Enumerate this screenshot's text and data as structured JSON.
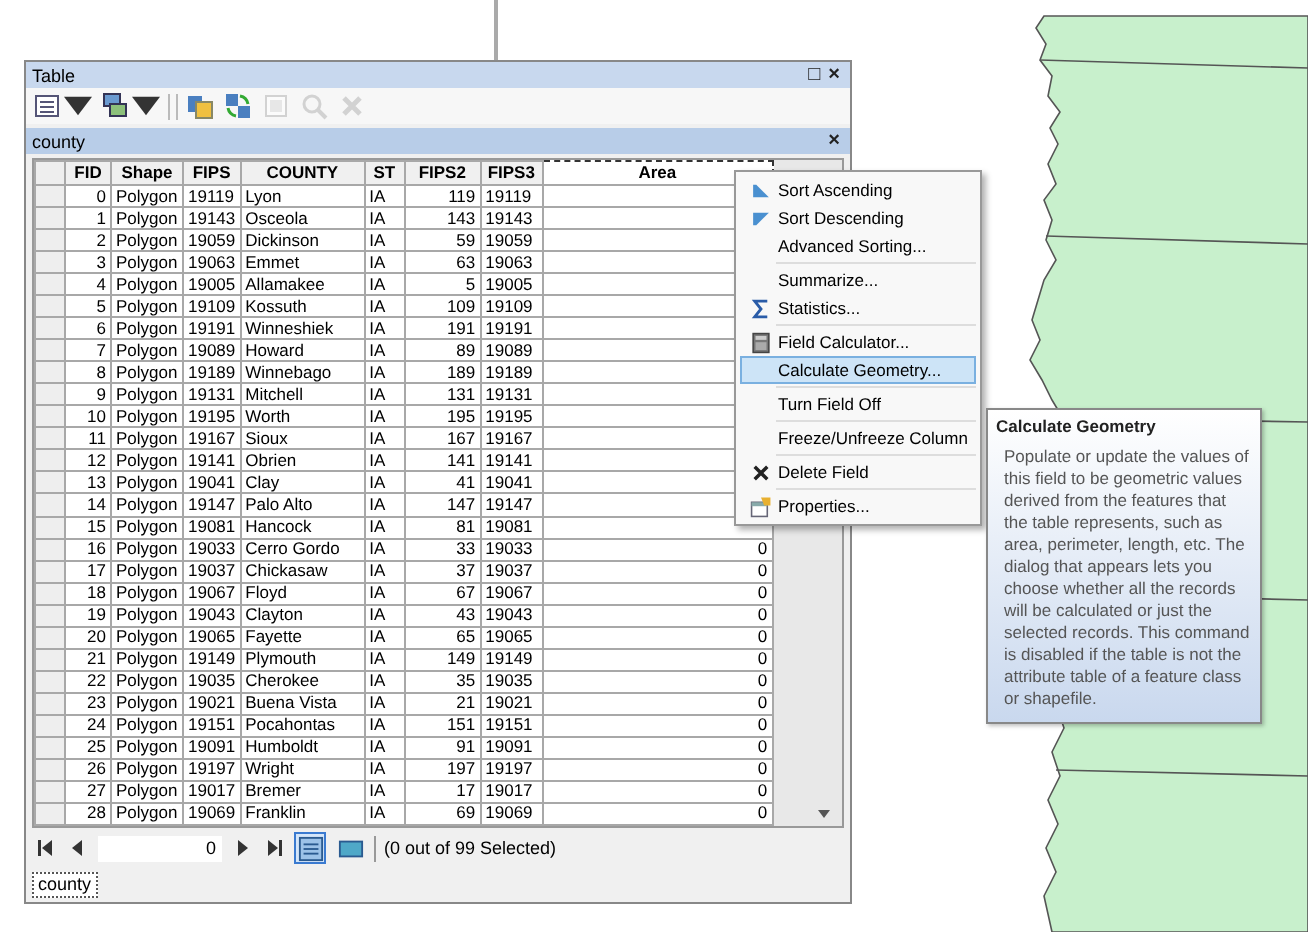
{
  "window": {
    "title": "Table",
    "title_buttons": [
      "□",
      "×"
    ]
  },
  "toolbar": [
    {
      "kind": "table-options",
      "dropdown": true,
      "disabled": false
    },
    {
      "kind": "related-tables",
      "dropdown": true,
      "disabled": false
    },
    {
      "kind": "select-by-attributes",
      "dropdown": false,
      "disabled": false
    },
    {
      "kind": "switch-selection",
      "dropdown": false,
      "disabled": false
    },
    {
      "kind": "clear-selection",
      "dropdown": false,
      "disabled": true
    },
    {
      "kind": "zoom-to-selected",
      "dropdown": false,
      "disabled": true
    },
    {
      "kind": "delete-selected",
      "dropdown": false,
      "disabled": true
    }
  ],
  "table_tab": {
    "title": "county",
    "close": "×"
  },
  "table": {
    "columns": [
      {
        "label": "FID",
        "selected": false
      },
      {
        "label": "Shape",
        "selected": false
      },
      {
        "label": "FIPS",
        "selected": false
      },
      {
        "label": "COUNTY",
        "selected": false
      },
      {
        "label": "ST",
        "selected": false
      },
      {
        "label": "FIPS2",
        "selected": false
      },
      {
        "label": "FIPS3",
        "selected": false
      },
      {
        "label": "Area",
        "selected": true
      }
    ],
    "rows": [
      {
        "cells": [
          "0",
          "Polygon",
          "19119",
          "Lyon",
          "IA",
          "119",
          "19119"
        ]
      },
      {
        "cells": [
          "1",
          "Polygon",
          "19143",
          "Osceola",
          "IA",
          "143",
          "19143"
        ]
      },
      {
        "cells": [
          "2",
          "Polygon",
          "19059",
          "Dickinson",
          "IA",
          "59",
          "19059"
        ]
      },
      {
        "cells": [
          "3",
          "Polygon",
          "19063",
          "Emmet",
          "IA",
          "63",
          "19063"
        ]
      },
      {
        "cells": [
          "4",
          "Polygon",
          "19005",
          "Allamakee",
          "IA",
          "5",
          "19005"
        ]
      },
      {
        "cells": [
          "5",
          "Polygon",
          "19109",
          "Kossuth",
          "IA",
          "109",
          "19109"
        ]
      },
      {
        "cells": [
          "6",
          "Polygon",
          "19191",
          "Winneshiek",
          "IA",
          "191",
          "19191"
        ]
      },
      {
        "cells": [
          "7",
          "Polygon",
          "19089",
          "Howard",
          "IA",
          "89",
          "19089"
        ]
      },
      {
        "cells": [
          "8",
          "Polygon",
          "19189",
          "Winnebago",
          "IA",
          "189",
          "19189"
        ]
      },
      {
        "cells": [
          "9",
          "Polygon",
          "19131",
          "Mitchell",
          "IA",
          "131",
          "19131"
        ]
      },
      {
        "cells": [
          "10",
          "Polygon",
          "19195",
          "Worth",
          "IA",
          "195",
          "19195"
        ]
      },
      {
        "cells": [
          "11",
          "Polygon",
          "19167",
          "Sioux",
          "IA",
          "167",
          "19167"
        ]
      },
      {
        "cells": [
          "12",
          "Polygon",
          "19141",
          "Obrien",
          "IA",
          "141",
          "19141"
        ]
      },
      {
        "cells": [
          "13",
          "Polygon",
          "19041",
          "Clay",
          "IA",
          "41",
          "19041"
        ]
      },
      {
        "cells": [
          "14",
          "Polygon",
          "19147",
          "Palo Alto",
          "IA",
          "147",
          "19147"
        ]
      },
      {
        "cells": [
          "15",
          "Polygon",
          "19081",
          "Hancock",
          "IA",
          "81",
          "19081"
        ]
      },
      {
        "cells": [
          "16",
          "Polygon",
          "19033",
          "Cerro Gordo",
          "IA",
          "33",
          "19033",
          "0"
        ]
      },
      {
        "cells": [
          "17",
          "Polygon",
          "19037",
          "Chickasaw",
          "IA",
          "37",
          "19037",
          "0"
        ]
      },
      {
        "cells": [
          "18",
          "Polygon",
          "19067",
          "Floyd",
          "IA",
          "67",
          "19067",
          "0"
        ]
      },
      {
        "cells": [
          "19",
          "Polygon",
          "19043",
          "Clayton",
          "IA",
          "43",
          "19043",
          "0"
        ]
      },
      {
        "cells": [
          "20",
          "Polygon",
          "19065",
          "Fayette",
          "IA",
          "65",
          "19065",
          "0"
        ]
      },
      {
        "cells": [
          "21",
          "Polygon",
          "19149",
          "Plymouth",
          "IA",
          "149",
          "19149",
          "0"
        ]
      },
      {
        "cells": [
          "22",
          "Polygon",
          "19035",
          "Cherokee",
          "IA",
          "35",
          "19035",
          "0"
        ]
      },
      {
        "cells": [
          "23",
          "Polygon",
          "19021",
          "Buena Vista",
          "IA",
          "21",
          "19021",
          "0"
        ]
      },
      {
        "cells": [
          "24",
          "Polygon",
          "19151",
          "Pocahontas",
          "IA",
          "151",
          "19151",
          "0"
        ]
      },
      {
        "cells": [
          "25",
          "Polygon",
          "19091",
          "Humboldt",
          "IA",
          "91",
          "19091",
          "0"
        ]
      },
      {
        "cells": [
          "26",
          "Polygon",
          "19197",
          "Wright",
          "IA",
          "197",
          "19197",
          "0"
        ]
      },
      {
        "cells": [
          "27",
          "Polygon",
          "19017",
          "Bremer",
          "IA",
          "17",
          "19017",
          "0"
        ]
      },
      {
        "cells": [
          "28",
          "Polygon",
          "19069",
          "Franklin",
          "IA",
          "69",
          "19069",
          "0"
        ]
      }
    ]
  },
  "navigation": {
    "record": "0",
    "views": [
      {
        "kind": "all-records",
        "selected": true
      },
      {
        "kind": "selected-records",
        "selected": false
      }
    ],
    "status": "(0 out of 99 Selected)"
  },
  "bottom_tabs": [
    {
      "label": "county",
      "selected": true
    }
  ],
  "context_menu": [
    {
      "kind": "sort-ascending",
      "label": "Sort Ascending",
      "selected": false
    },
    {
      "kind": "sort-descending",
      "label": "Sort Descending",
      "selected": false
    },
    {
      "kind": "plain",
      "label": "Advanced Sorting...",
      "selected": false
    },
    {
      "kind": "separator"
    },
    {
      "kind": "plain",
      "label": "Summarize...",
      "selected": false
    },
    {
      "kind": "sigma",
      "label": "Statistics...",
      "selected": false
    },
    {
      "kind": "separator"
    },
    {
      "kind": "calculator",
      "label": "Field Calculator...",
      "selected": false
    },
    {
      "kind": "plain",
      "label": "Calculate Geometry...",
      "selected": true
    },
    {
      "kind": "separator"
    },
    {
      "kind": "plain",
      "label": "Turn Field Off",
      "selected": false
    },
    {
      "kind": "separator"
    },
    {
      "kind": "plain",
      "label": "Freeze/Unfreeze Column",
      "selected": false
    },
    {
      "kind": "separator"
    },
    {
      "kind": "delete",
      "label": "Delete Field",
      "selected": false
    },
    {
      "kind": "separator"
    },
    {
      "kind": "properties",
      "label": "Properties...",
      "selected": false
    }
  ],
  "tooltip": {
    "title": "Calculate Geometry",
    "text": "Populate or update the values of this field to be geometric values derived from the features that the table represents, such as area, perimeter, length, etc. The dialog that appears lets you choose whether all the records will be calculated or just the selected records. This command is disabled if the table is not the attribute table of a feature class or shapefile."
  }
}
